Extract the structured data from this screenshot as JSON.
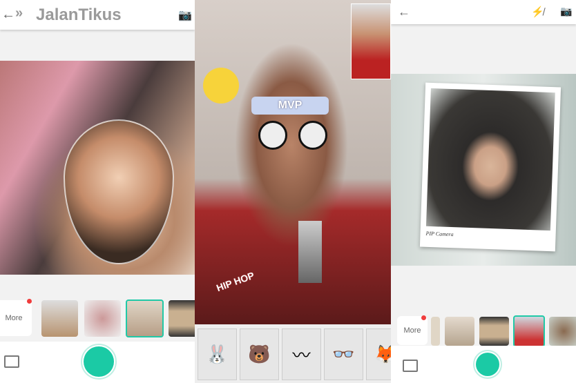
{
  "left_screen": {
    "logo_text": "JalanTikus",
    "back_icon": "arrow-left-icon",
    "camera_switch_icon": "camera-switch-icon",
    "more_label": "More",
    "thumbnails": [
      "glass-frame",
      "heart-locket-frame",
      "water-drop-frame",
      "film-strip-frame"
    ],
    "selected_thumbnail": 2
  },
  "middle_screen": {
    "headband_text": "MVP",
    "sticker_text": "HIP HOP",
    "sticker_tiles": [
      "bunny-skater",
      "bear-sticker",
      "braids-headband",
      "round-glasses",
      "dancing-character"
    ]
  },
  "right_screen": {
    "back_icon": "arrow-left-icon",
    "flash_off_icon": "flash-off-icon",
    "camera_switch_icon": "camera-switch-icon",
    "frame_caption": "PIP Camera",
    "more_label": "More",
    "thumbnails": [
      "water-drop-partial",
      "water-drop-frame",
      "film-strip-frame",
      "polaroid-frame",
      "bubble-frame"
    ],
    "selected_thumbnail": 3
  },
  "colors": {
    "accent": "#1bcaa5",
    "notification": "#f03c3c"
  }
}
